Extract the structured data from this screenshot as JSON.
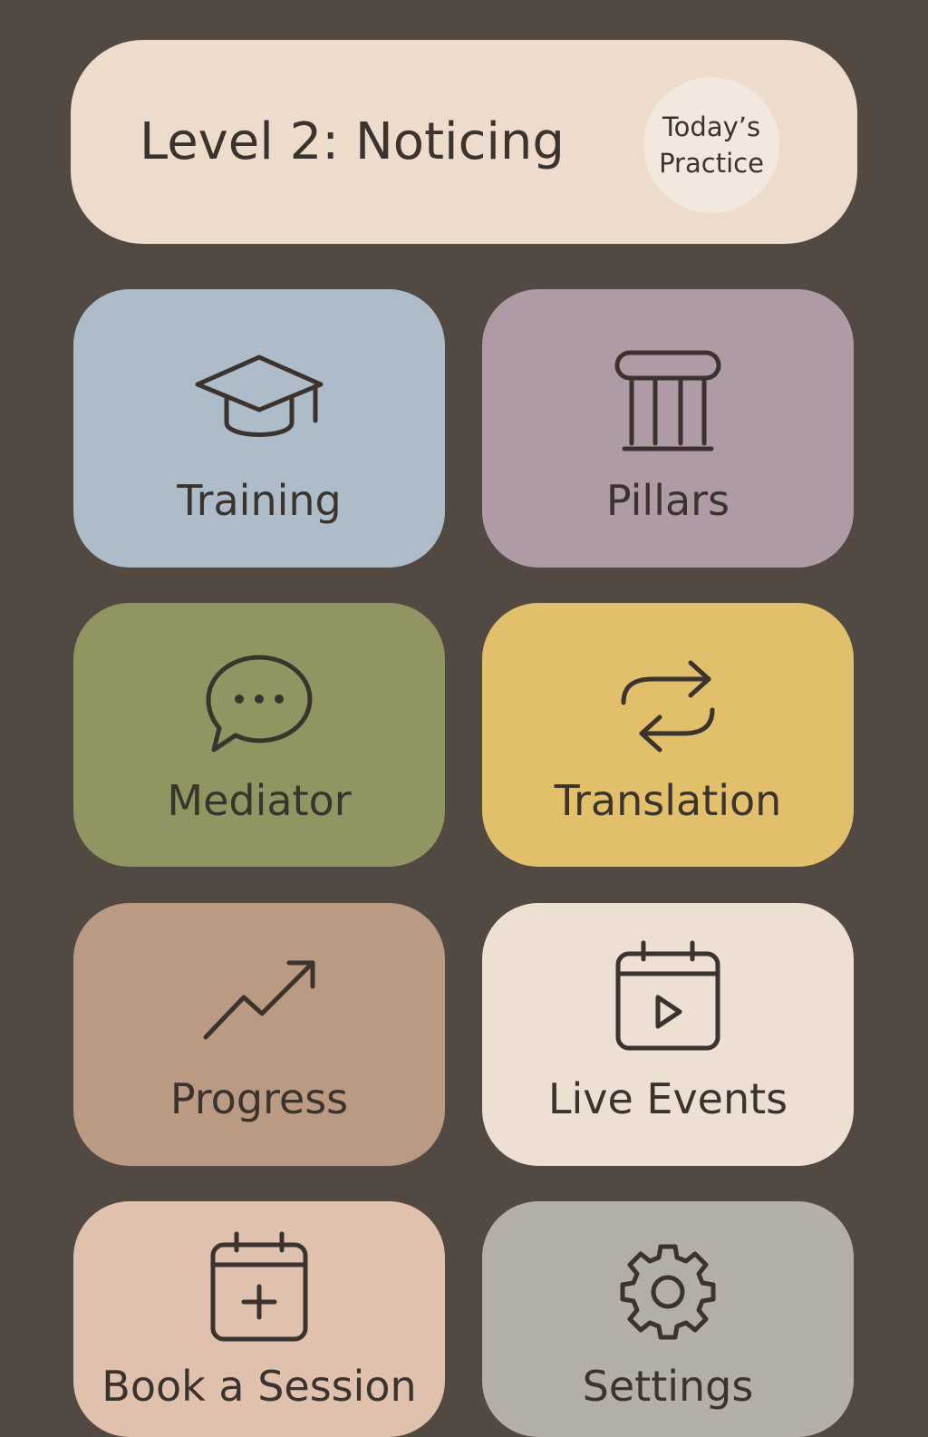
{
  "header": {
    "title": "Level 2: Noticing",
    "practice_line1": "Today’s",
    "practice_line2": "Practice"
  },
  "tiles": [
    {
      "label": "Training",
      "icon": "graduation-cap-icon",
      "color": "#adbcc8"
    },
    {
      "label": "Pillars",
      "icon": "pillar-icon",
      "color": "#af9ba6"
    },
    {
      "label": "Mediator",
      "icon": "chat-bubble-icon",
      "color": "#919562"
    },
    {
      "label": "Translation",
      "icon": "swap-arrows-icon",
      "color": "#e1bf6b"
    },
    {
      "label": "Progress",
      "icon": "trending-up-icon",
      "color": "#ba9a82"
    },
    {
      "label": "Live Events",
      "icon": "calendar-play-icon",
      "color": "#eddfd2"
    },
    {
      "label": "Book a Session",
      "icon": "calendar-plus-icon",
      "color": "#e0c1ae"
    },
    {
      "label": "Settings",
      "icon": "gear-icon",
      "color": "#b3aea7"
    }
  ],
  "colors": {
    "background": "#524942",
    "header": "#eddbcc",
    "text": "#3b332d"
  }
}
